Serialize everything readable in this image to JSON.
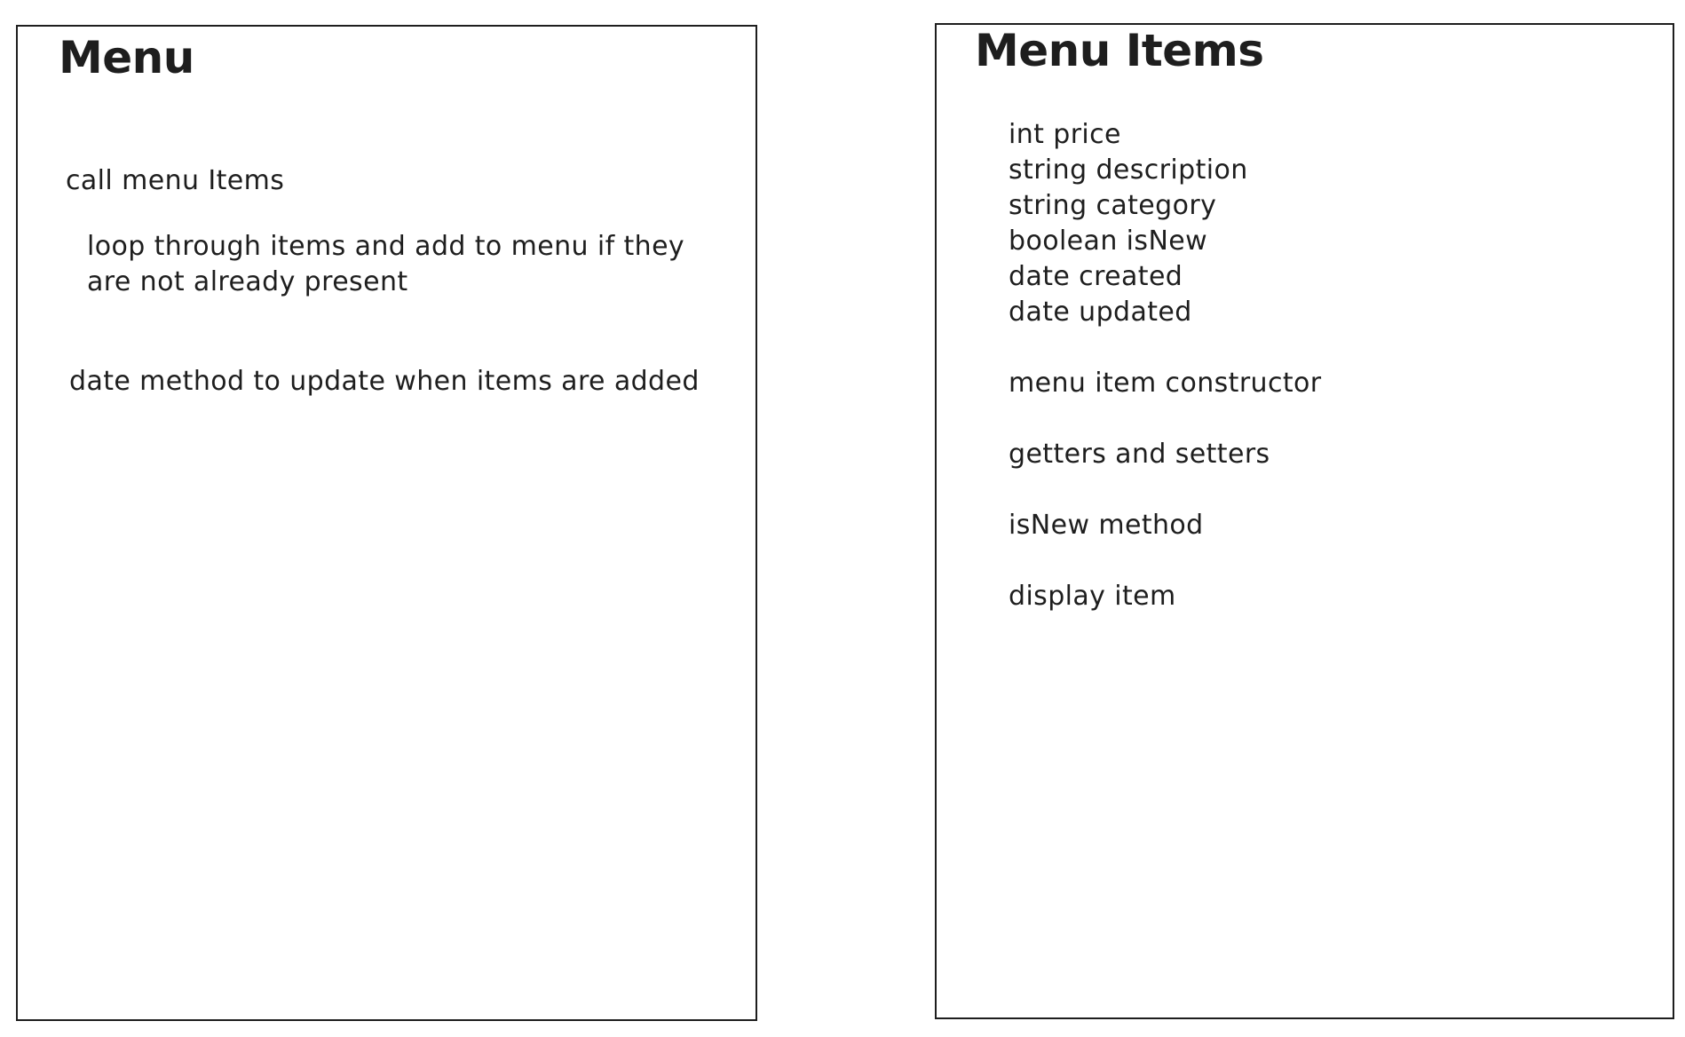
{
  "menu_box": {
    "title": "Menu",
    "notes": [
      "call menu Items",
      "loop through items and add to menu if they\nare not already present",
      "date method to update when items are added"
    ]
  },
  "menu_items_box": {
    "title": "Menu Items",
    "fields": [
      "int price",
      "string description",
      "string category",
      "boolean isNew",
      "date created",
      "date updated"
    ],
    "methods": [
      "menu item constructor",
      "getters and setters",
      "isNew method",
      "display item"
    ]
  },
  "colors": {
    "stroke": "#1e1e1e",
    "background": "#ffffff"
  }
}
